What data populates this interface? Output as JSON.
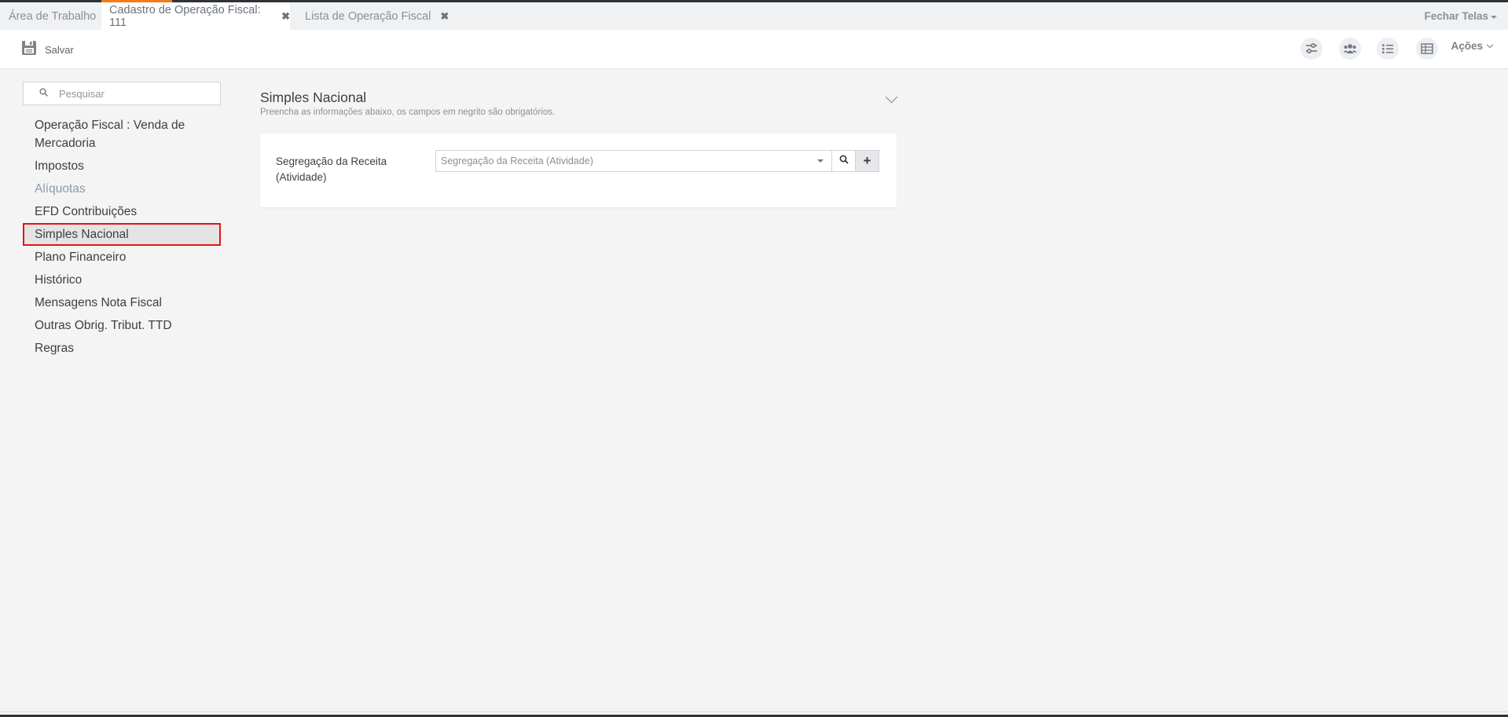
{
  "tabs": [
    {
      "label": "Área de Trabalho",
      "active": false,
      "closable": false
    },
    {
      "label": "Cadastro de Operação Fiscal: 111",
      "active": true,
      "closable": true
    },
    {
      "label": "Lista de Operação Fiscal",
      "active": false,
      "closable": true
    }
  ],
  "tab_close_glyph": "✖",
  "fechar_telas_label": "Fechar Telas",
  "toolbar": {
    "save_label": "Salvar",
    "save_icon": "floppy-disk-icon",
    "icons": [
      "sliders-icon",
      "users-icon",
      "list-icon",
      "table-icon"
    ],
    "acoes_label": "Ações"
  },
  "sidebar": {
    "search_placeholder": "Pesquisar",
    "items": [
      {
        "label": "Operação Fiscal : Venda de Mercadoria",
        "state": "normal"
      },
      {
        "label": "Impostos",
        "state": "normal"
      },
      {
        "label": "Alíquotas",
        "state": "muted"
      },
      {
        "label": "EFD Contribuições",
        "state": "normal"
      },
      {
        "label": "Simples Nacional",
        "state": "selected"
      },
      {
        "label": "Plano Financeiro",
        "state": "normal"
      },
      {
        "label": "Histórico",
        "state": "normal"
      },
      {
        "label": "Mensagens Nota Fiscal",
        "state": "normal"
      },
      {
        "label": "Outras Obrig. Tribut. TTD",
        "state": "normal"
      },
      {
        "label": "Regras",
        "state": "normal"
      }
    ]
  },
  "section": {
    "title": "Simples Nacional",
    "subtitle": "Preencha as informações abaixo, os campos em negrito são obrigatórios.",
    "field_label": "Segregação da Receita (Atividade)",
    "field_placeholder": "Segregação da Receita (Atividade)",
    "add_glyph": "+"
  },
  "colors": {
    "accent_orange": "#f07d1a",
    "selected_outline": "#e0141a",
    "top_strip": "#2f3237"
  }
}
